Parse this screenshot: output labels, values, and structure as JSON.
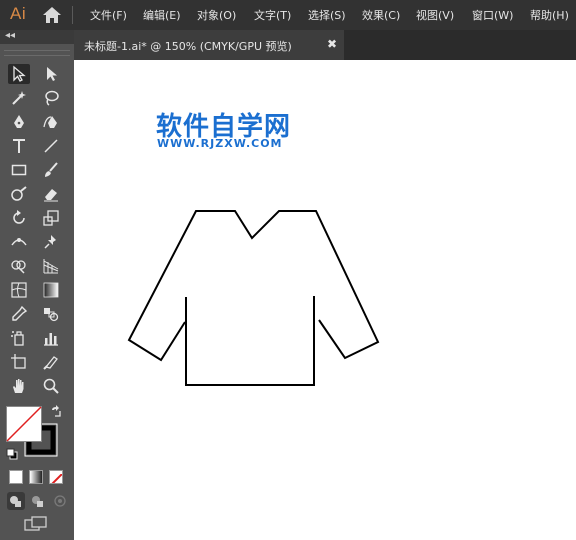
{
  "app": {
    "logo": "Ai"
  },
  "menu": {
    "items": [
      "文件(F)",
      "编辑(E)",
      "对象(O)",
      "文字(T)",
      "选择(S)",
      "效果(C)",
      "视图(V)",
      "窗口(W)",
      "帮助(H)"
    ]
  },
  "document": {
    "tab_title": "未标题-1.ai* @ 150% (CMYK/GPU 预览)",
    "close_glyph": "✖"
  },
  "toolbar": {
    "collapse_glyph": "◂◂"
  },
  "artboard": {
    "watermark_title": "软件自学网",
    "watermark_url": "WWW.RJZXW.COM"
  },
  "colors": {
    "watermark": "#1b6fd0",
    "fill_swatch": "#ffffff",
    "stroke_swatch": "#000000",
    "none_slash": "#e02020"
  }
}
